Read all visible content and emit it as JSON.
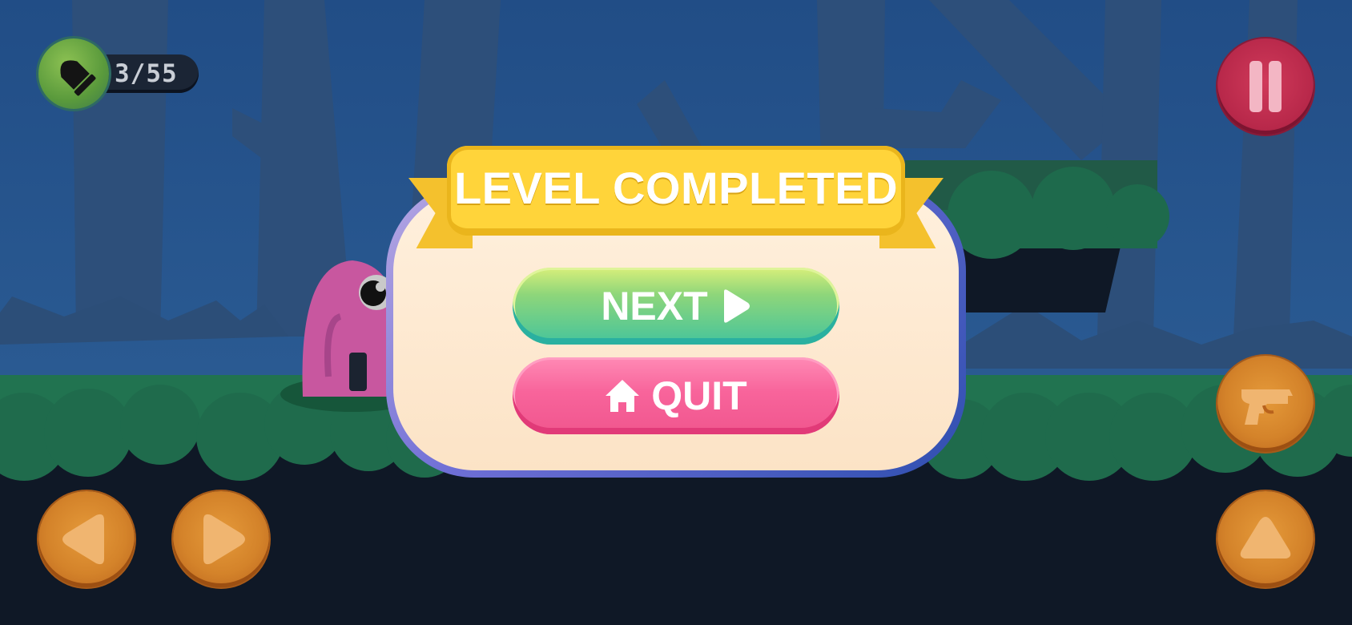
{
  "hud": {
    "ammo_counter": "3/55"
  },
  "dialog": {
    "title": "LEVEL COMPLETED",
    "next_label": "NEXT",
    "quit_label": "QUIT"
  },
  "icons": {
    "ammo": "bullet-icon",
    "pause": "pause-icon",
    "next": "play-triangle-icon",
    "quit": "home-icon",
    "fire": "gun-icon",
    "left": "arrow-left-icon",
    "right": "arrow-right-icon",
    "jump": "arrow-up-icon"
  },
  "colors": {
    "banner": "#ffd43a",
    "next_button": "#45c49c",
    "quit_button": "#f0568e",
    "pause_button": "#b8284a",
    "control_button": "#d4832a",
    "dialog_border": "#2f4fb0",
    "dialog_fill": "#fff0dd"
  }
}
